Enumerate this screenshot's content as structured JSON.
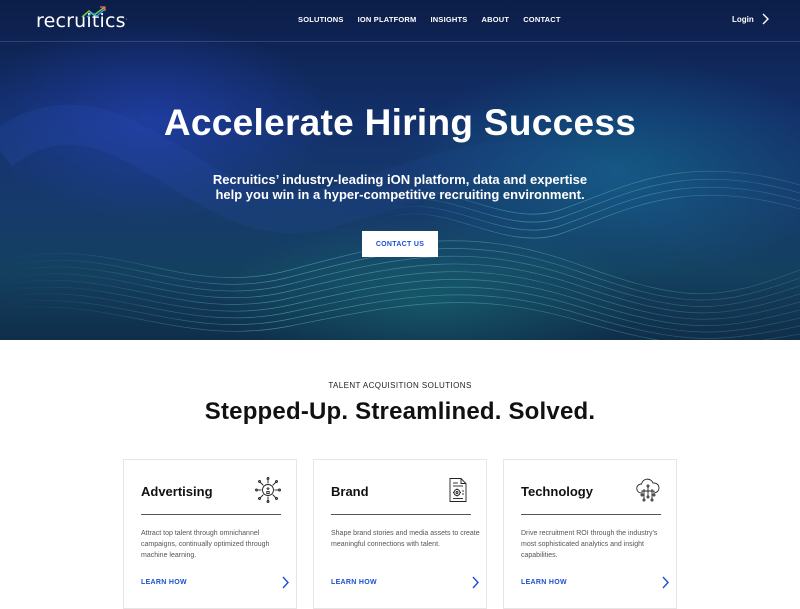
{
  "brand": {
    "logo_text": "recruitics",
    "accent_colors": [
      "#3aa7e8",
      "#7cc24b",
      "#f26b4f"
    ]
  },
  "nav": {
    "items": [
      {
        "label": "SOLUTIONS"
      },
      {
        "label": "iON PLATFORM"
      },
      {
        "label": "INSIGHTS"
      },
      {
        "label": "ABOUT"
      },
      {
        "label": "CONTACT"
      }
    ],
    "login_label": "Login"
  },
  "hero": {
    "title": "Accelerate Hiring Success",
    "subtitle_line1": "Recruitics’ industry-leading iON platform, data and expertise",
    "subtitle_line2": "help you win in a hyper-competitive recruiting environment.",
    "cta_label": "CONTACT US"
  },
  "solutions": {
    "eyebrow": "TALENT ACQUISITION SOLUTIONS",
    "title": "Stepped-Up. Streamlined. Solved.",
    "cards": [
      {
        "title": "Advertising",
        "icon": "advertising-network-icon",
        "description": "Attract top talent through omnichannel campaigns, continually optimized through machine learning.",
        "link_label": "LEARN HOW"
      },
      {
        "title": "Brand",
        "icon": "brand-document-icon",
        "description": "Shape brand stories and media assets to create meaningful connections with talent.",
        "link_label": "LEARN HOW"
      },
      {
        "title": "Technology",
        "icon": "cloud-circuit-icon",
        "description": "Drive recruitment ROI through the industry’s most sophisticated analytics and insight capabilities.",
        "link_label": "LEARN HOW"
      }
    ]
  },
  "colors": {
    "link_blue": "#1a4fd6",
    "hero_dark": "#0c1d48",
    "white": "#ffffff"
  }
}
